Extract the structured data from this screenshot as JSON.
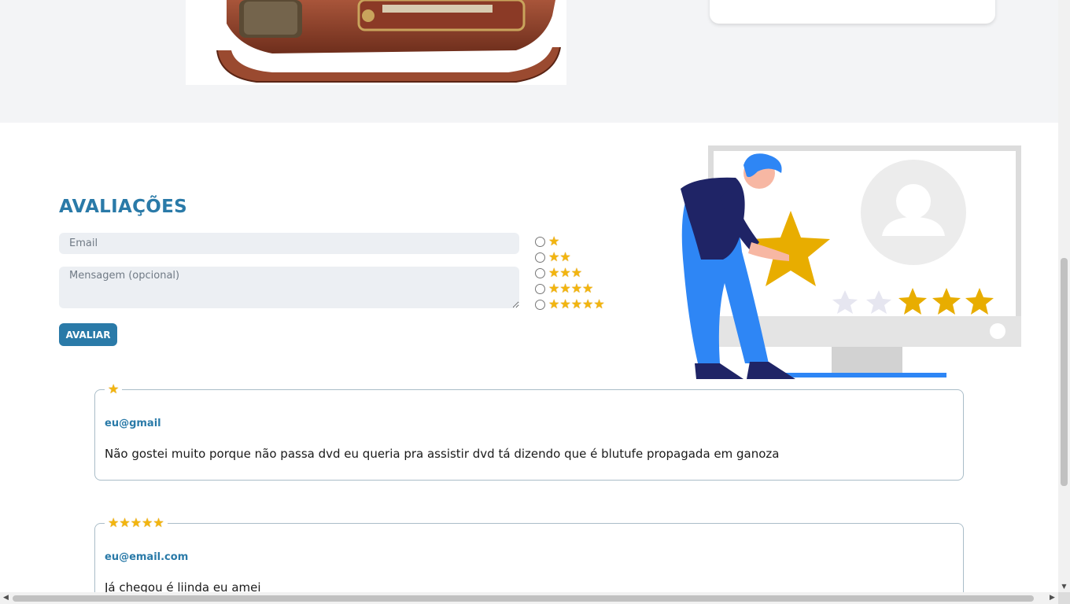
{
  "product": {
    "image_name": "vintage-radio-image"
  },
  "ratings_section": {
    "title": "AVALIAÇÕES",
    "email_placeholder": "Email",
    "message_placeholder": "Mensagem (opcional)",
    "submit_label": "AVALIAR",
    "options": [
      {
        "stars": "★",
        "value": 1
      },
      {
        "stars": "★★",
        "value": 2
      },
      {
        "stars": "★★★",
        "value": 3
      },
      {
        "stars": "★★★★",
        "value": 4
      },
      {
        "stars": "★★★★★",
        "value": 5
      }
    ]
  },
  "illustration": {
    "name": "person-holding-star-illustration",
    "stars_shown": 5,
    "stars_filled": 3
  },
  "reviews": [
    {
      "stars": "★",
      "rating": 1,
      "email": "eu@gmail",
      "text": "Não gostei muito porque não passa dvd eu queria pra assistir dvd tá dizendo que é blutufe propagada em ganoza"
    },
    {
      "stars": "★★★★★",
      "rating": 5,
      "email": "eu@email.com",
      "text": "Já chegou é liinda eu amei"
    }
  ],
  "colors": {
    "accent": "#2a7aa8",
    "star": "#f2b50f",
    "input_bg": "#eceff3",
    "band_bg": "#f3f4f6"
  },
  "scroll": {
    "vertical_thumb_fraction": 0.38
  }
}
